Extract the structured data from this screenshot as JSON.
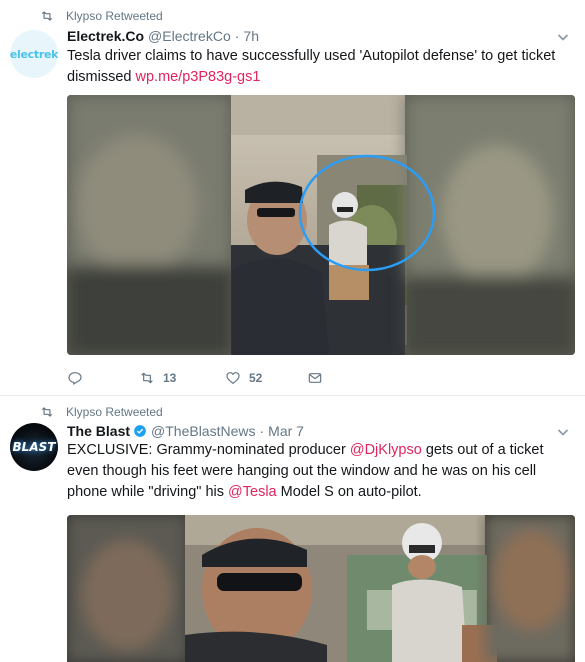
{
  "tweets": [
    {
      "retweeted_by": "Klypso Retweeted",
      "avatar_text": "electrek",
      "name": "Electrek.Co",
      "handle": "@ElectrekCo",
      "separator": "·",
      "time": "7h",
      "text": "Tesla driver claims to have successfully used 'Autopilot defense' to get ticket dismissed",
      "link": "wp.me/p3P83g-gs1",
      "actions": {
        "reply_count": "",
        "retweet_count": "13",
        "like_count": "52"
      }
    },
    {
      "retweeted_by": "Klypso Retweeted",
      "avatar_text": "BLAST",
      "name": "The Blast",
      "handle": "@TheBlastNews",
      "separator": "·",
      "time": "Mar 7",
      "text_1": "EXCLUSIVE: Grammy-nominated producer ",
      "mention_1": "@DjKlypso",
      "text_2": " gets out of a ticket even though his feet were hanging out the window and he was on his cell phone while \"driving\" his ",
      "mention_2": "@Tesla",
      "text_3": " Model S on auto-pilot."
    }
  ],
  "colors": {
    "accent_link": "#e0245e",
    "muted": "#657786",
    "highlight_circle": "#2b9df4",
    "verified": "#1da1f2"
  },
  "icons": [
    "retweet-icon",
    "reply-icon",
    "like-icon",
    "message-icon",
    "chevron-down-icon",
    "verified-badge-icon"
  ]
}
